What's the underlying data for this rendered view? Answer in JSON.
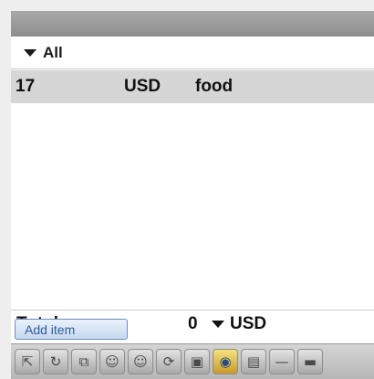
{
  "filter": {
    "label": "All",
    "icon": "dropdown-triangle-icon"
  },
  "items": [
    {
      "amount": "17",
      "currency": "USD",
      "category": "food"
    }
  ],
  "total": {
    "label": "Total:",
    "value": "0",
    "currency": "USD"
  },
  "add_button": {
    "label": "Add item"
  },
  "toolbar": {
    "icons": [
      {
        "name": "up-arrow-icon",
        "glyph": "⇱"
      },
      {
        "name": "refresh-icon",
        "glyph": "↻"
      },
      {
        "name": "copy-icon",
        "glyph": "⧉"
      },
      {
        "name": "people-icon",
        "glyph": "☺"
      },
      {
        "name": "people-group-icon",
        "glyph": "☺"
      },
      {
        "name": "sync-icon",
        "glyph": "⟳"
      },
      {
        "name": "device-icon",
        "glyph": "▣"
      },
      {
        "name": "globe-icon",
        "glyph": "◉"
      },
      {
        "name": "window-icon",
        "glyph": "▤"
      },
      {
        "name": "minimize-icon",
        "glyph": "—"
      },
      {
        "name": "collapse-icon",
        "glyph": "▬"
      }
    ]
  }
}
